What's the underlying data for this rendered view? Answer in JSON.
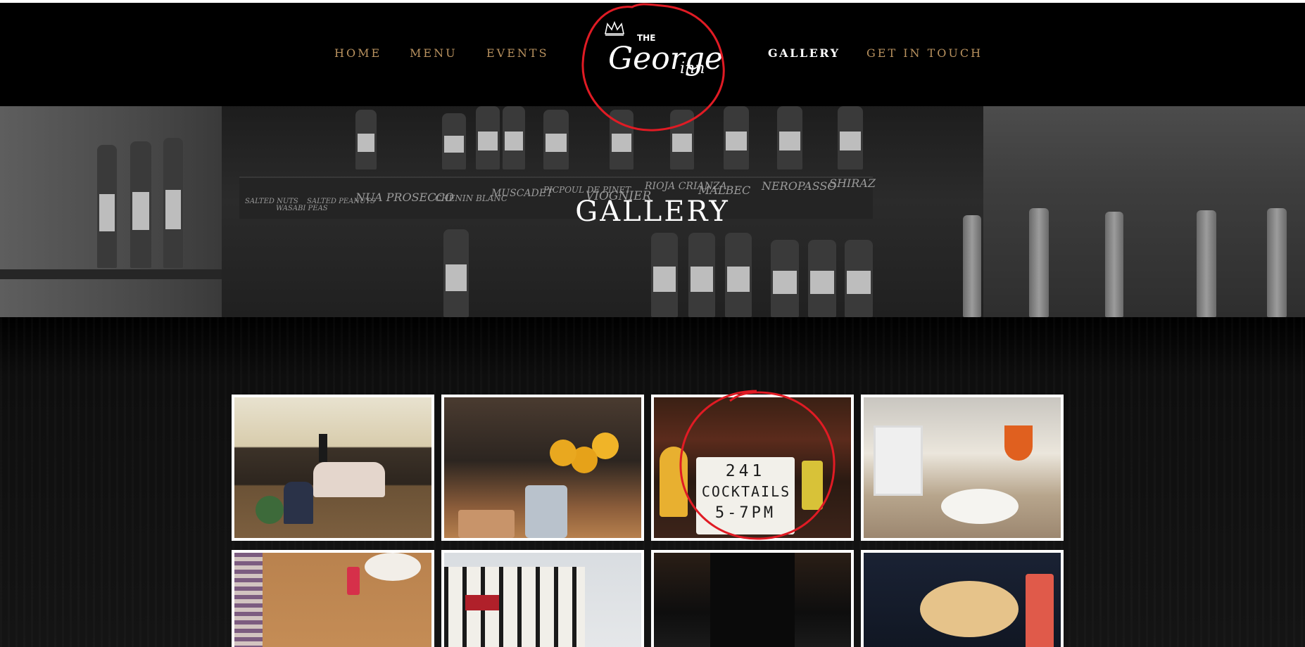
{
  "nav": {
    "left": [
      "HOME",
      "MENU",
      "EVENTS"
    ],
    "right": [
      "GALLERY",
      "GET IN TOUCH"
    ],
    "active": "GALLERY"
  },
  "logo": {
    "small": "THE",
    "script": "George",
    "suffix": "inn"
  },
  "hero": {
    "title": "GALLERY",
    "chalkboard": [
      "SALTED NUTS",
      "WASABI PEAS",
      "SALTED PEANUTS",
      "NUA PROSECCO",
      "CHENIN BLANC",
      "MUSCADET",
      "PICPOUL DE PINET",
      "VIOGNIER",
      "RIOJA CRIANZA",
      "MALBEC",
      "NEROPASSO",
      "SHIRAZ"
    ]
  },
  "gallery": {
    "items": [
      {
        "name": "lounge-sofa"
      },
      {
        "name": "sunflowers-bar"
      },
      {
        "name": "cocktails-sign",
        "sign": [
          "241",
          "COCKTAILS",
          "5-7PM"
        ]
      },
      {
        "name": "spritz-dish"
      },
      {
        "name": "dining-table"
      },
      {
        "name": "pub-exterior"
      },
      {
        "name": "bartender"
      },
      {
        "name": "pornstar-martini"
      }
    ]
  },
  "colors": {
    "nav": "#b9925f",
    "nav_active": "#ffffff",
    "annotation": "#e01b24"
  }
}
